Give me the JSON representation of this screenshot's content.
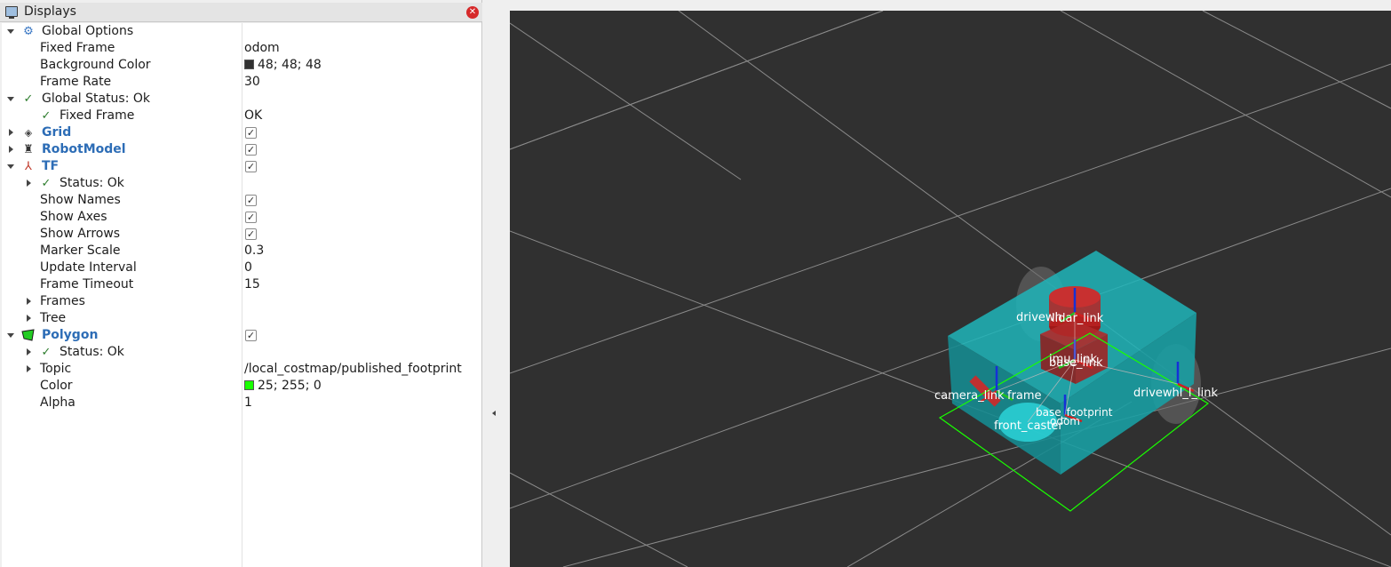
{
  "panel": {
    "title": "Displays"
  },
  "rows": {
    "global_options": "Global Options",
    "fixed_frame_label": "Fixed Frame",
    "fixed_frame_value": "odom",
    "bg_color_label": "Background Color",
    "bg_color_value": "48; 48; 48",
    "bg_color_hex": "#303030",
    "frame_rate_label": "Frame Rate",
    "frame_rate_value": "30",
    "global_status": "Global Status: Ok",
    "gs_fixed_frame_label": "Fixed Frame",
    "gs_fixed_frame_value": "OK",
    "grid": "Grid",
    "robot_model": "RobotModel",
    "tf": "TF",
    "tf_status": "Status: Ok",
    "show_names": "Show Names",
    "show_axes": "Show Axes",
    "show_arrows": "Show Arrows",
    "marker_scale_label": "Marker Scale",
    "marker_scale_value": "0.3",
    "update_interval_label": "Update Interval",
    "update_interval_value": "0",
    "frame_timeout_label": "Frame Timeout",
    "frame_timeout_value": "15",
    "frames": "Frames",
    "tree": "Tree",
    "polygon": "Polygon",
    "polygon_status": "Status: Ok",
    "topic_label": "Topic",
    "topic_value": "/local_costmap/published_footprint",
    "color_label": "Color",
    "color_value": "25; 255; 0",
    "color_hex": "#19ff00",
    "alpha_label": "Alpha",
    "alpha_value": "1"
  },
  "scene": {
    "frames": {
      "drivewhl_l": "drivewh",
      "lidar": "lidar_link",
      "imu": "imu_link",
      "base": "base_link",
      "camera": "camera_link",
      "camera_frame": "frame",
      "drivewhl_r": "drivewhl_l_link",
      "base_footprint": "base_footprint",
      "front_caster": "front_caster",
      "odom": "odom"
    },
    "colors": {
      "background": "#303030",
      "grid": "#9a9a9a",
      "chassis": "#1aa3a8",
      "lidar": "#b01e1e",
      "footprint": "#19ff00"
    }
  }
}
